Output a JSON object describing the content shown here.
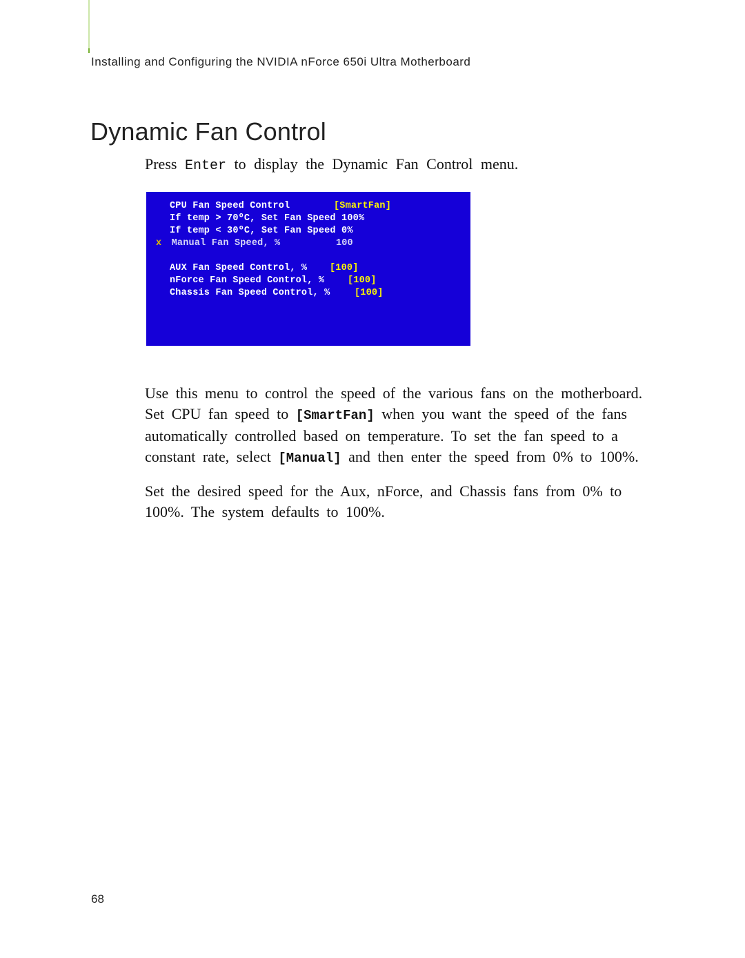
{
  "runningHead": "Installing and Configuring the NVIDIA nForce 650i Ultra Motherboard",
  "heading": "Dynamic Fan Control",
  "intro": {
    "pre": "Press ",
    "key": "Enter",
    "post": " to display the Dynamic Fan Control menu."
  },
  "bios": {
    "cpu": {
      "label": "CPU Fan Speed Control",
      "value": "[SmartFan]"
    },
    "rule_hi": "If temp > 70ºC, Set Fan Speed 100%",
    "rule_lo": "If temp < 30ºC, Set Fan Speed   0%",
    "manual": {
      "x": "x",
      "label": "Manual Fan Speed, %",
      "value": "100"
    },
    "aux": {
      "label": "AUX Fan Speed Control, %",
      "value": "[100]"
    },
    "nforce": {
      "label": "nForce Fan Speed Control, %",
      "value": "[100]"
    },
    "chassis": {
      "label": "Chassis Fan Speed Control, %",
      "value": "[100]"
    }
  },
  "para1": {
    "a": "Use this menu to control the speed of the various fans on the motherboard. Set CPU fan speed to ",
    "smart": "[SmartFan]",
    "b": " when you want the speed of the fans automatically controlled based on temperature. To set the fan speed to a constant rate, select ",
    "manual": "[Manual]",
    "c": " and then enter the speed from 0% to 100%."
  },
  "para2": "Set the desired speed for the Aux, nForce, and Chassis fans from 0% to 100%. The system defaults to 100%.",
  "pageNumber": "68"
}
